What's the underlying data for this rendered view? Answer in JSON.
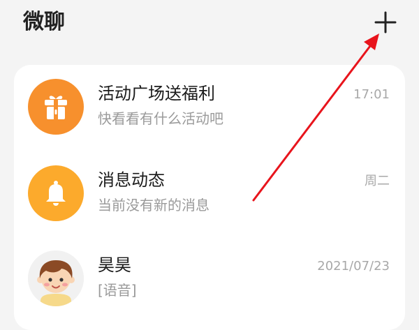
{
  "header": {
    "title": "微聊"
  },
  "icons": {
    "add": "plus-icon",
    "gift": "gift-icon",
    "bell": "bell-icon",
    "avatar": "user-avatar",
    "arrow": "red-arrow-annotation"
  },
  "colors": {
    "accent_orange": "#f7902d",
    "accent_yellow": "#fcaa2c",
    "annotation_red": "#e8141c"
  },
  "chats": [
    {
      "title": "活动广场送福利",
      "preview": "快看看有什么活动吧",
      "time": "17:01"
    },
    {
      "title": "消息动态",
      "preview": "当前没有新的消息",
      "time": "周二"
    },
    {
      "title": "昊昊",
      "preview": "[语音]",
      "time": "2021/07/23"
    }
  ]
}
